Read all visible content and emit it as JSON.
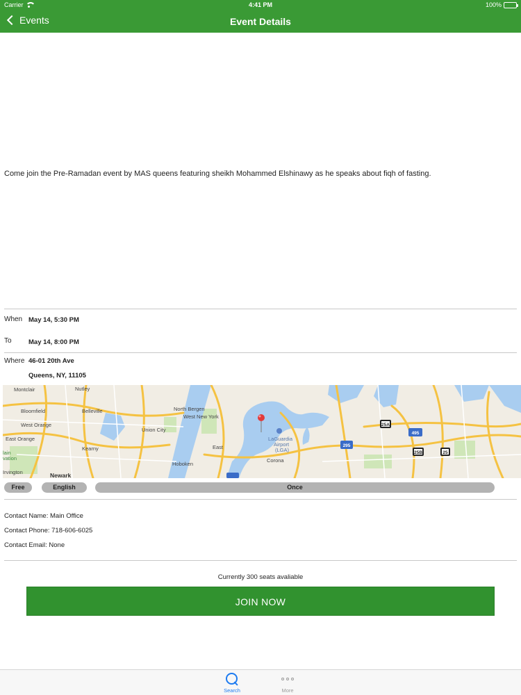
{
  "status_bar": {
    "carrier": "Carrier",
    "time": "4:41 PM",
    "battery": "100%"
  },
  "nav": {
    "back_label": "Events",
    "title": "Event Details"
  },
  "event": {
    "description": "Come join the Pre-Ramadan event by MAS queens featuring sheikh Mohammed Elshinawy as he speaks about fiqh of fasting.",
    "when_label": "When",
    "when_value": "May 14, 5:30 PM",
    "to_label": "To",
    "to_value": "May 14, 8:00 PM",
    "where_label": "Where",
    "address_line1": "46-01 20th Ave",
    "address_line2": "Queens, NY, 11105"
  },
  "map": {
    "labels": [
      "Montclair",
      "Nutley",
      "Bloomfield",
      "Belleville",
      "North Bergen",
      "West New York",
      "West Orange",
      "Union City",
      "East Orange",
      "Kearny",
      "Hoboken",
      "East",
      "LaGuardia",
      "Airport",
      "(LGA)",
      "Corona",
      "Newark",
      "Irvington",
      "lain",
      "vation"
    ],
    "shields": [
      "25A",
      "495",
      "295",
      "25B",
      "25"
    ]
  },
  "tags": {
    "price": "Free",
    "language": "English",
    "frequency": "Once"
  },
  "contact": {
    "name": "Contact Name: Main Office",
    "phone": "Contact Phone: 718-606-6025",
    "email": "Contact Email: None"
  },
  "seats_text": "Currently 300 seats avaliable",
  "join_label": "JOIN NOW",
  "tabbar": {
    "search_label": "Search",
    "more_label": "More"
  },
  "colors": {
    "brand_green": "#3a9a35",
    "button_green": "#31922f",
    "tab_active": "#1d7bf0"
  }
}
